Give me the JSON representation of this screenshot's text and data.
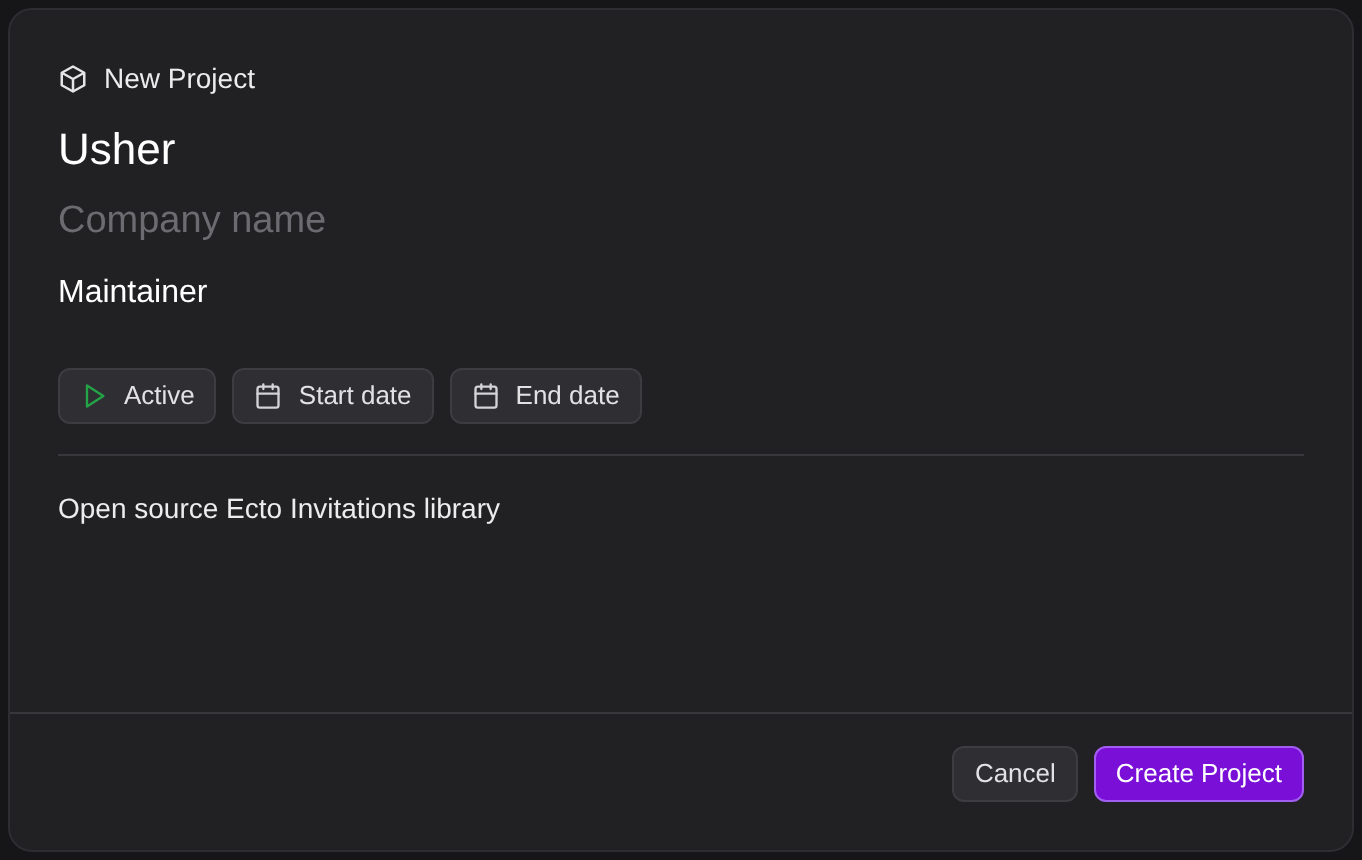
{
  "dialog": {
    "title": "New Project"
  },
  "fields": [
    {
      "kind": "title",
      "value": "Usher"
    },
    {
      "kind": "subtitle",
      "placeholder": "Company name"
    },
    {
      "kind": "role",
      "value": "Maintainer"
    }
  ],
  "chips": [
    {
      "kind": "status",
      "label": "Active"
    },
    {
      "kind": "date",
      "label": "Start date"
    },
    {
      "kind": "date",
      "label": "End date"
    }
  ],
  "description": "Open source Ecto Invitations library",
  "buttons": [
    {
      "kind": "secondary",
      "label": "Cancel"
    },
    {
      "kind": "primary",
      "label": "Create Project"
    }
  ]
}
